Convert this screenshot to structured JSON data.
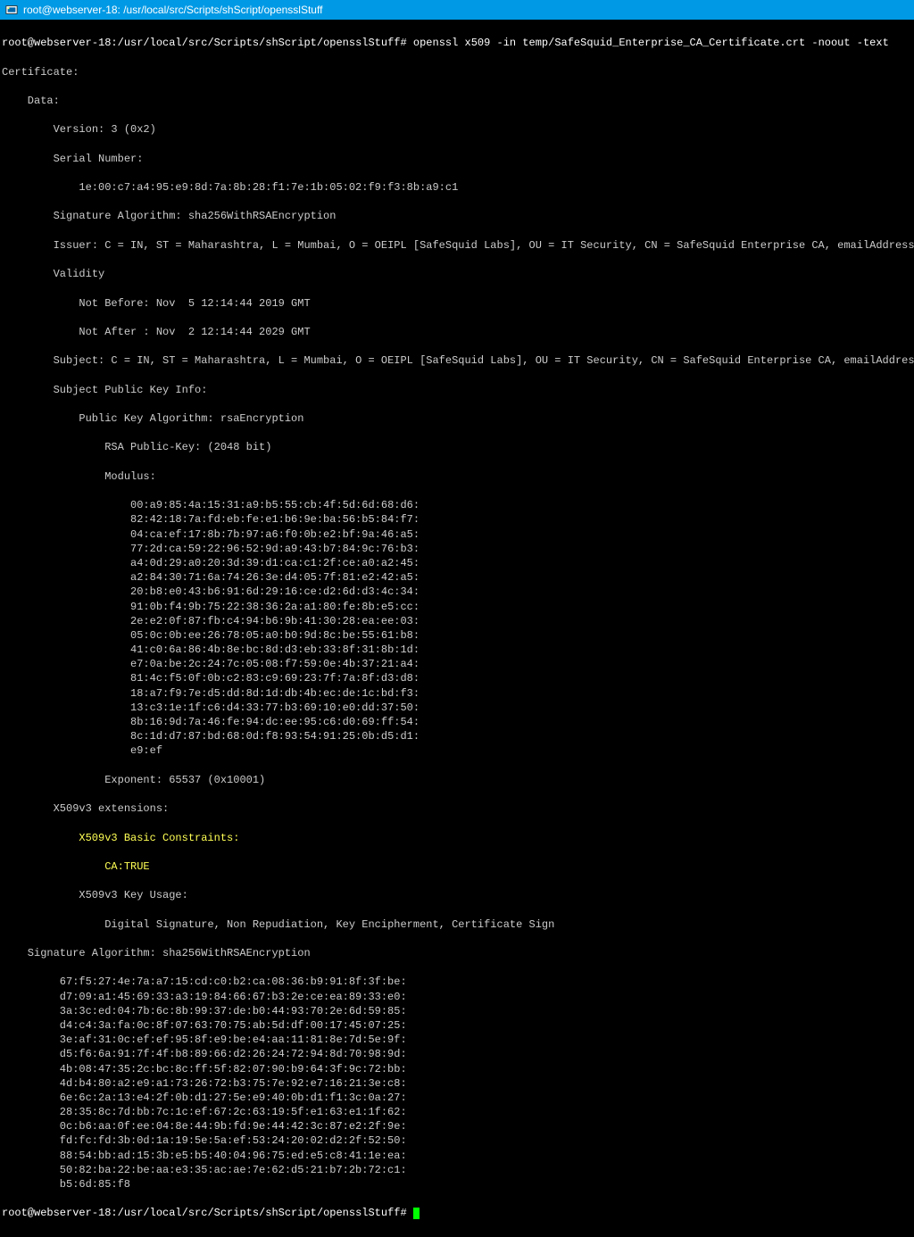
{
  "window": {
    "title": "root@webserver-18: /usr/local/src/Scripts/shScript/opensslStuff"
  },
  "prompt": {
    "user_host": "root@webserver-18",
    "cwd": "/usr/local/src/Scripts/shScript/opensslStuff",
    "symbol": "#"
  },
  "command": "openssl x509 -in temp/SafeSquid_Enterprise_CA_Certificate.crt -noout -text",
  "output": {
    "cert_header": "Certificate:",
    "data_header": "Data:",
    "version": "Version: 3 (0x2)",
    "serial_number_label": "Serial Number:",
    "serial_number": "1e:00:c7:a4:95:e9:8d:7a:8b:28:f1:7e:1b:05:02:f9:f3:8b:a9:c1",
    "sig_alg1": "Signature Algorithm: sha256WithRSAEncryption",
    "issuer": "Issuer: C = IN, ST = Maharashtra, L = Mumbai, O = OEIPL [SafeSquid Labs], OU = IT Security, CN = SafeSquid Enterprise CA, emailAddress = support@safesquid.net",
    "validity_label": "Validity",
    "not_before": "Not Before: Nov  5 12:14:44 2019 GMT",
    "not_after": "Not After : Nov  2 12:14:44 2029 GMT",
    "subject": "Subject: C = IN, ST = Maharashtra, L = Mumbai, O = OEIPL [SafeSquid Labs], OU = IT Security, CN = SafeSquid Enterprise CA, emailAddress = support@safesquid.net",
    "spki_label": "Subject Public Key Info:",
    "pka": "Public Key Algorithm: rsaEncryption",
    "rsa_key": "RSA Public-Key: (2048 bit)",
    "modulus_label": "Modulus:",
    "modulus": [
      "00:a9:85:4a:15:31:a9:b5:55:cb:4f:5d:6d:68:d6:",
      "82:42:18:7a:fd:eb:fe:e1:b6:9e:ba:56:b5:84:f7:",
      "04:ca:ef:17:8b:7b:97:a6:f0:0b:e2:bf:9a:46:a5:",
      "77:2d:ca:59:22:96:52:9d:a9:43:b7:84:9c:76:b3:",
      "a4:0d:29:a0:20:3d:39:d1:ca:c1:2f:ce:a0:a2:45:",
      "a2:84:30:71:6a:74:26:3e:d4:05:7f:81:e2:42:a5:",
      "20:b8:e0:43:b6:91:6d:29:16:ce:d2:6d:d3:4c:34:",
      "91:0b:f4:9b:75:22:38:36:2a:a1:80:fe:8b:e5:cc:",
      "2e:e2:0f:87:fb:c4:94:b6:9b:41:30:28:ea:ee:03:",
      "05:0c:0b:ee:26:78:05:a0:b0:9d:8c:be:55:61:b8:",
      "41:c0:6a:86:4b:8e:bc:8d:d3:eb:33:8f:31:8b:1d:",
      "e7:0a:be:2c:24:7c:05:08:f7:59:0e:4b:37:21:a4:",
      "81:4c:f5:0f:0b:c2:83:c9:69:23:7f:7a:8f:d3:d8:",
      "18:a7:f9:7e:d5:dd:8d:1d:db:4b:ec:de:1c:bd:f3:",
      "13:c3:1e:1f:c6:d4:33:77:b3:69:10:e0:dd:37:50:",
      "8b:16:9d:7a:46:fe:94:dc:ee:95:c6:d0:69:ff:54:",
      "8c:1d:d7:87:bd:68:0d:f8:93:54:91:25:0b:d5:d1:",
      "e9:ef"
    ],
    "exponent": "Exponent: 65537 (0x10001)",
    "x509v3_ext_label": "X509v3 extensions:",
    "basic_constraints_label": "X509v3 Basic Constraints:",
    "ca_true": "CA:TRUE",
    "key_usage_label": "X509v3 Key Usage:",
    "key_usage": "Digital Signature, Non Repudiation, Key Encipherment, Certificate Sign",
    "sig_alg2": "Signature Algorithm: sha256WithRSAEncryption",
    "signature": [
      "67:f5:27:4e:7a:a7:15:cd:c0:b2:ca:08:36:b9:91:8f:3f:be:",
      "d7:09:a1:45:69:33:a3:19:84:66:67:b3:2e:ce:ea:89:33:e0:",
      "3a:3c:ed:04:7b:6c:8b:99:37:de:b0:44:93:70:2e:6d:59:85:",
      "d4:c4:3a:fa:0c:8f:07:63:70:75:ab:5d:df:00:17:45:07:25:",
      "3e:af:31:0c:ef:ef:95:8f:e9:be:e4:aa:11:81:8e:7d:5e:9f:",
      "d5:f6:6a:91:7f:4f:b8:89:66:d2:26:24:72:94:8d:70:98:9d:",
      "4b:08:47:35:2c:bc:8c:ff:5f:82:07:90:b9:64:3f:9c:72:bb:",
      "4d:b4:80:a2:e9:a1:73:26:72:b3:75:7e:92:e7:16:21:3e:c8:",
      "6e:6c:2a:13:e4:2f:0b:d1:27:5e:e9:40:0b:d1:f1:3c:0a:27:",
      "28:35:8c:7d:bb:7c:1c:ef:67:2c:63:19:5f:e1:63:e1:1f:62:",
      "0c:b6:aa:0f:ee:04:8e:44:9b:fd:9e:44:42:3c:87:e2:2f:9e:",
      "fd:fc:fd:3b:0d:1a:19:5e:5a:ef:53:24:20:02:d2:2f:52:50:",
      "88:54:bb:ad:15:3b:e5:b5:40:04:96:75:ed:e5:c8:41:1e:ea:",
      "50:82:ba:22:be:aa:e3:35:ac:ae:7e:62:d5:21:b7:2b:72:c1:",
      "b5:6d:85:f8"
    ]
  }
}
